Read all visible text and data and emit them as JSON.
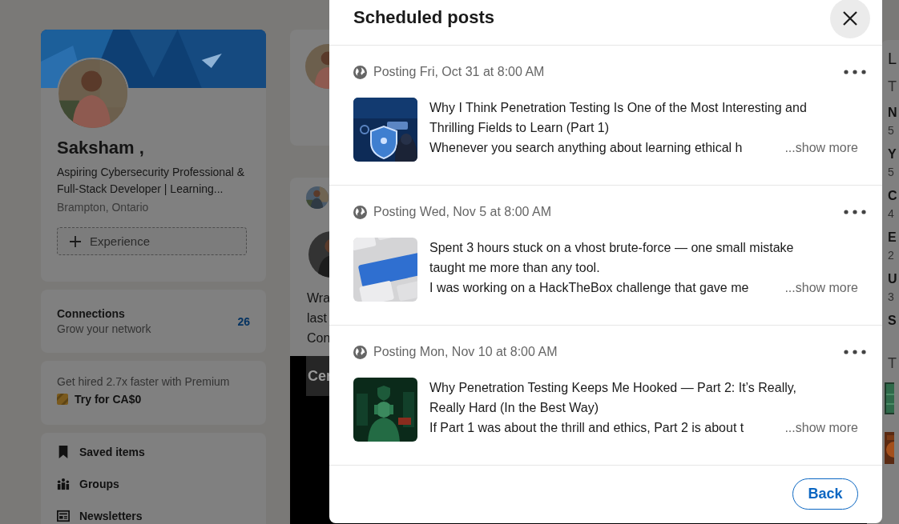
{
  "profile": {
    "name": "Saksham ,",
    "headline": "Aspiring Cybersecurity Professional & Full-Stack Developer | Learning...",
    "location": "Brampton, Ontario",
    "add_button": "Experience"
  },
  "connections": {
    "label": "Connections",
    "count": "26",
    "subtitle": "Grow your network"
  },
  "premium": {
    "text": "Get hired 2.7x faster with Premium",
    "cta": "Try for CA$0"
  },
  "nav_items": [
    {
      "label": "Saved items"
    },
    {
      "label": "Groups"
    },
    {
      "label": "Newsletters"
    }
  ],
  "feed": {
    "post_fragments": [
      "Wra",
      "last",
      "Con"
    ],
    "banner_fragment": "Cer"
  },
  "right_rail": {
    "title": "L",
    "subtitle": "T",
    "items": [
      {
        "title": "N",
        "meta": "5"
      },
      {
        "title": "Y",
        "meta": "5"
      },
      {
        "title": "C",
        "meta": "4"
      },
      {
        "title": "E",
        "meta": "2"
      },
      {
        "title": "U",
        "meta": "3"
      }
    ],
    "more": "S",
    "section": "T"
  },
  "modal": {
    "title": "Scheduled posts",
    "posts": [
      {
        "schedule": "Posting Fri, Oct 31 at 8:00 AM",
        "title": "Why I Think Penetration Testing Is One of the Most Interesting and Thrilling Fields to Learn (Part 1)",
        "excerpt": "Whenever you search anything about learning ethical h",
        "show_more": "...show more"
      },
      {
        "schedule": "Posting Wed, Nov 5 at 8:00 AM",
        "title": "Spent 3 hours stuck on a vhost brute-force — one small mistake taught me more than any tool.",
        "excerpt": "I was working on a HackTheBox challenge that gave me",
        "show_more": "...show more"
      },
      {
        "schedule": "Posting Mon, Nov 10 at 8:00 AM",
        "title": "Why Penetration Testing Keeps Me Hooked — Part 2: It’s Really, Really Hard (In the Best Way)",
        "excerpt": "If Part 1 was about the thrill and ethics, Part 2 is about t",
        "show_more": "...show more"
      }
    ],
    "back_button": "Back"
  }
}
